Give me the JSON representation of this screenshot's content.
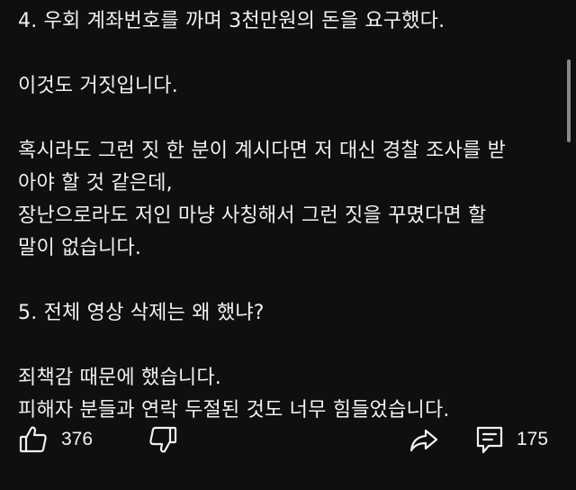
{
  "post": {
    "lines_block1": [
      "4. 우회 계좌번호를 까며 3천만원의 돈을 요구했다."
    ],
    "lines_block2": [
      "이것도 거짓입니다."
    ],
    "lines_block3": [
      "혹시라도 그런 짓 한 분이 계시다면 저 대신 경찰 조사를 받",
      "아야 할 것 같은데,",
      "장난으로라도 저인 마냥 사칭해서 그런 짓을 꾸몄다면 할",
      "말이 없습니다."
    ],
    "lines_block4": [
      "5. 전체 영상 삭제는 왜 했냐?"
    ],
    "lines_block5": [
      "죄책감 때문에 했습니다.",
      "피해자 분들과 연락 두절된 것도 너무 힘들었습니다."
    ]
  },
  "actions": {
    "like_icon": "thumbs-up-icon",
    "like_count": "376",
    "dislike_icon": "thumbs-down-icon",
    "share_icon": "share-arrow-icon",
    "comment_icon": "comment-icon",
    "comment_count": "175"
  },
  "colors": {
    "background": "#0f0f0f",
    "text": "#f1f1f1",
    "scrollbar": "#8a8a8a"
  }
}
